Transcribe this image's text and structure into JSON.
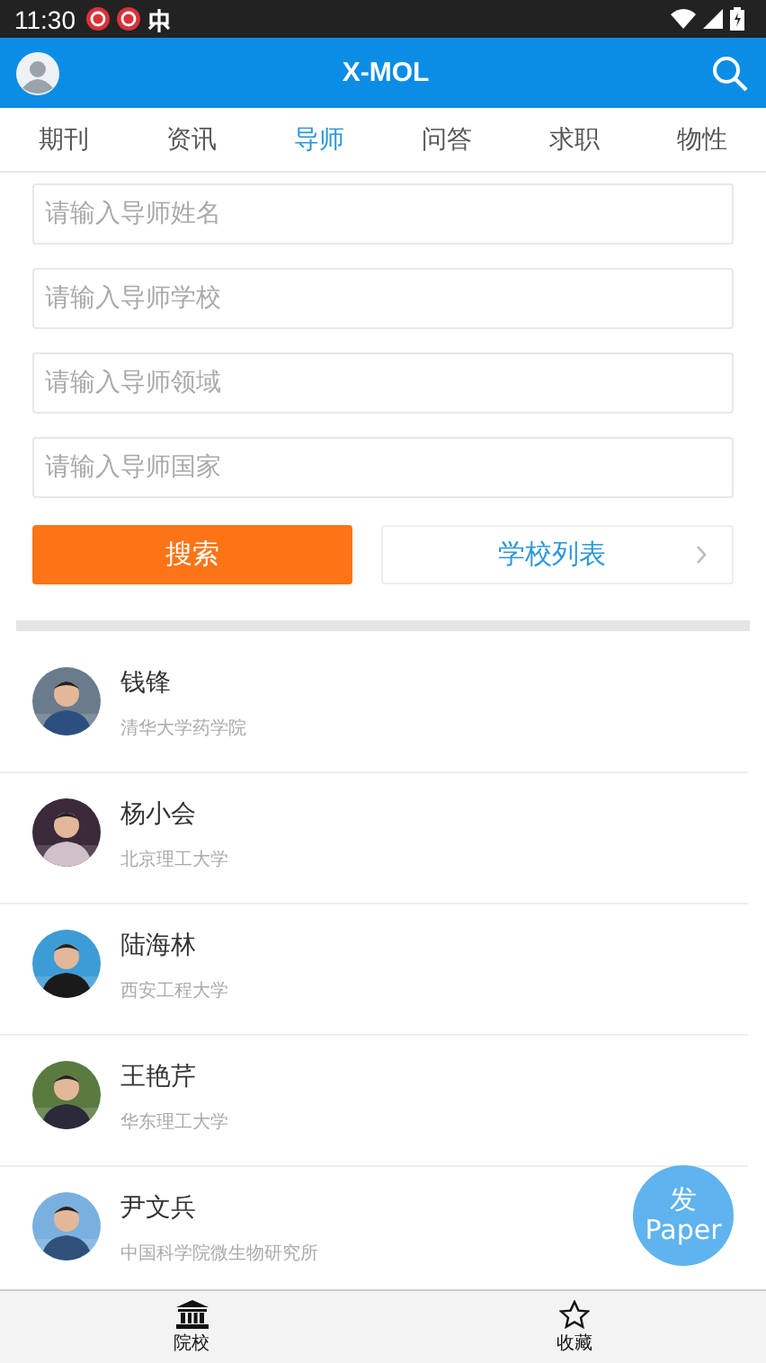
{
  "status_bar": {
    "time": "11:30"
  },
  "app_bar": {
    "title": "X-MOL"
  },
  "tabs": [
    {
      "label": "期刊",
      "selected": false
    },
    {
      "label": "资讯",
      "selected": false
    },
    {
      "label": "导师",
      "selected": true
    },
    {
      "label": "问答",
      "selected": false
    },
    {
      "label": "求职",
      "selected": false
    },
    {
      "label": "物性",
      "selected": false
    }
  ],
  "search_fields": [
    {
      "placeholder": "请输入导师姓名"
    },
    {
      "placeholder": "请输入导师学校"
    },
    {
      "placeholder": "请输入导师领域"
    },
    {
      "placeholder": "请输入导师国家"
    }
  ],
  "search_button": "搜索",
  "school_list_button": "学校列表",
  "advisors": [
    {
      "name": "钱锋",
      "affiliation": "清华大学药学院"
    },
    {
      "name": "杨小会",
      "affiliation": "北京理工大学"
    },
    {
      "name": "陆海林",
      "affiliation": "西安工程大学"
    },
    {
      "name": "王艳芹",
      "affiliation": "华东理工大学"
    },
    {
      "name": "尹文兵",
      "affiliation": "中国科学院微生物研究所"
    }
  ],
  "fab": {
    "line_1": "发",
    "line_2": "Paper"
  },
  "bottom_nav": [
    {
      "label": "院校",
      "kind": "building"
    },
    {
      "label": "收藏",
      "kind": "star"
    }
  ]
}
